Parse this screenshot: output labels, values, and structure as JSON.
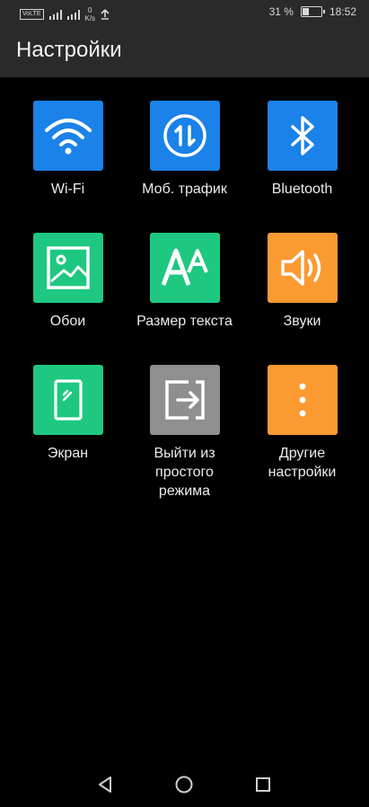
{
  "status_bar": {
    "net_badge": "VoLTE",
    "speed_value": "0",
    "speed_unit": "K/s",
    "battery_text": "31 %",
    "battery_level": 0.31,
    "time": "18:52"
  },
  "app_bar": {
    "title": "Настройки"
  },
  "tiles": [
    {
      "label": "Wi-Fi",
      "color": "#1a82e8",
      "icon": "wifi-icon"
    },
    {
      "label": "Моб. трафик",
      "color": "#1a82e8",
      "icon": "mobile-data-icon"
    },
    {
      "label": "Bluetooth",
      "color": "#1a82e8",
      "icon": "bluetooth-icon"
    },
    {
      "label": "Обои",
      "color": "#1ec880",
      "icon": "wallpaper-icon"
    },
    {
      "label": "Размер текста",
      "color": "#1ec880",
      "icon": "text-size-icon"
    },
    {
      "label": "Звуки",
      "color": "#fb9a31",
      "icon": "sound-icon"
    },
    {
      "label": "Экран",
      "color": "#1ec880",
      "icon": "display-icon"
    },
    {
      "label": "Выйти из простого режима",
      "color": "#8f8f8f",
      "icon": "exit-icon"
    },
    {
      "label": "Другие настройки",
      "color": "#fb9a31",
      "icon": "more-icon"
    }
  ],
  "nav": {
    "back": "back-icon",
    "home": "home-icon",
    "recents": "recents-icon"
  }
}
